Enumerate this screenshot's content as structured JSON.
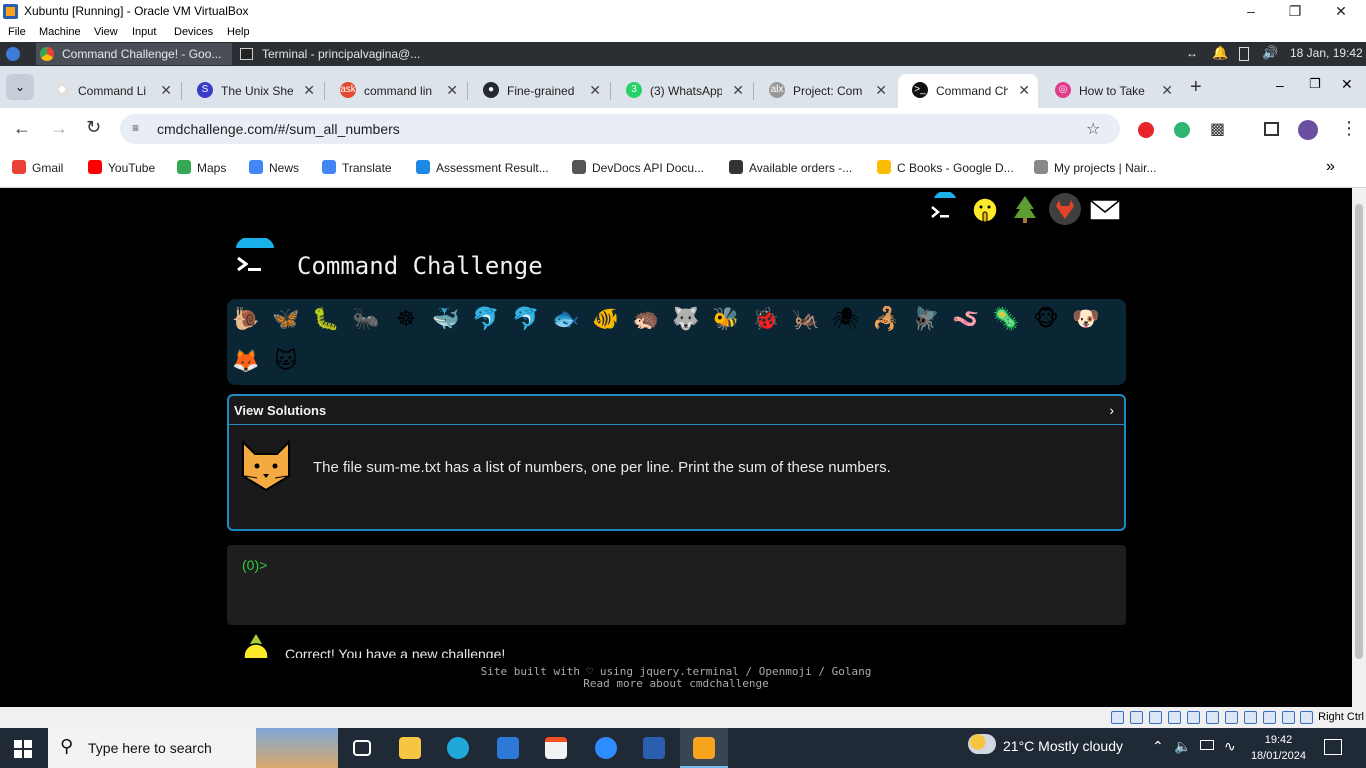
{
  "vbox": {
    "title": "Xubuntu [Running] - Oracle VM VirtualBox",
    "menu": [
      "File",
      "Machine",
      "View",
      "Input",
      "Devices",
      "Help"
    ],
    "host_key": "Right Ctrl"
  },
  "xfce": {
    "tasks": [
      "Command Challenge! - Goo...",
      "Terminal - principalvagina@..."
    ],
    "clock": "18 Jan, 19:42"
  },
  "tabs": [
    {
      "label": "Command Li",
      "fav": "◆",
      "color": "#e0e0e0"
    },
    {
      "label": "The Unix She",
      "fav": "S",
      "color": "#3b3bc9"
    },
    {
      "label": "command lin",
      "fav": "ask",
      "color": "#e2492f"
    },
    {
      "label": "Fine-grained",
      "fav": "●",
      "color": "#24292f"
    },
    {
      "label": "(3) WhatsApp",
      "fav": "3",
      "color": "#25d366"
    },
    {
      "label": "Project: Com",
      "fav": "alx",
      "color": "#999999"
    },
    {
      "label": "Command Ch",
      "fav": ">_",
      "color": "#111111"
    },
    {
      "label": "How to Take",
      "fav": "◎",
      "color": "#e23c8c"
    }
  ],
  "address": {
    "url": "cmdchallenge.com/#/sum_all_numbers"
  },
  "bookmarks": [
    {
      "label": "Gmail",
      "color": "#ea4335"
    },
    {
      "label": "YouTube",
      "color": "#ff0000"
    },
    {
      "label": "Maps",
      "color": "#34a853"
    },
    {
      "label": "News",
      "color": "#4285f4"
    },
    {
      "label": "Translate",
      "color": "#4285f4"
    },
    {
      "label": "Assessment Result...",
      "color": "#1e88e5"
    },
    {
      "label": "DevDocs API Docu...",
      "color": "#555555"
    },
    {
      "label": "Available orders -...",
      "color": "#333333"
    },
    {
      "label": "C Books - Google D...",
      "color": "#fbbc04"
    },
    {
      "label": "My projects | Nair...",
      "color": "#888888"
    }
  ],
  "page": {
    "app_title": "Command Challenge",
    "view_solutions": "View Solutions",
    "chevron": "›",
    "challenge_text": "The file sum-me.txt has a list of numbers, one per line. Print the sum of these numbers.",
    "prompt": "(0)>",
    "correct_message": "Correct! You have a new challenge!",
    "footer_line1": "Site built with ♡ using jquery.terminal / Openmoji / Golang",
    "footer_line2": "Read more about cmdchallenge",
    "animals": [
      "🐌",
      "🦋",
      "🐛",
      "🐜",
      "☸",
      "🐳",
      "🐬",
      "🐬",
      "🐟",
      "🐠",
      "🦔",
      "🐺",
      "🐝",
      "🐞",
      "🦗",
      "🕷",
      "🦂",
      "🪰",
      "🪱",
      "🦠",
      "🐵",
      "🐶",
      "🦊",
      "🐱"
    ]
  },
  "taskbar": {
    "search_placeholder": "Type here to search",
    "weather": "21°C  Mostly cloudy",
    "time": "19:42",
    "date": "18/01/2024"
  }
}
